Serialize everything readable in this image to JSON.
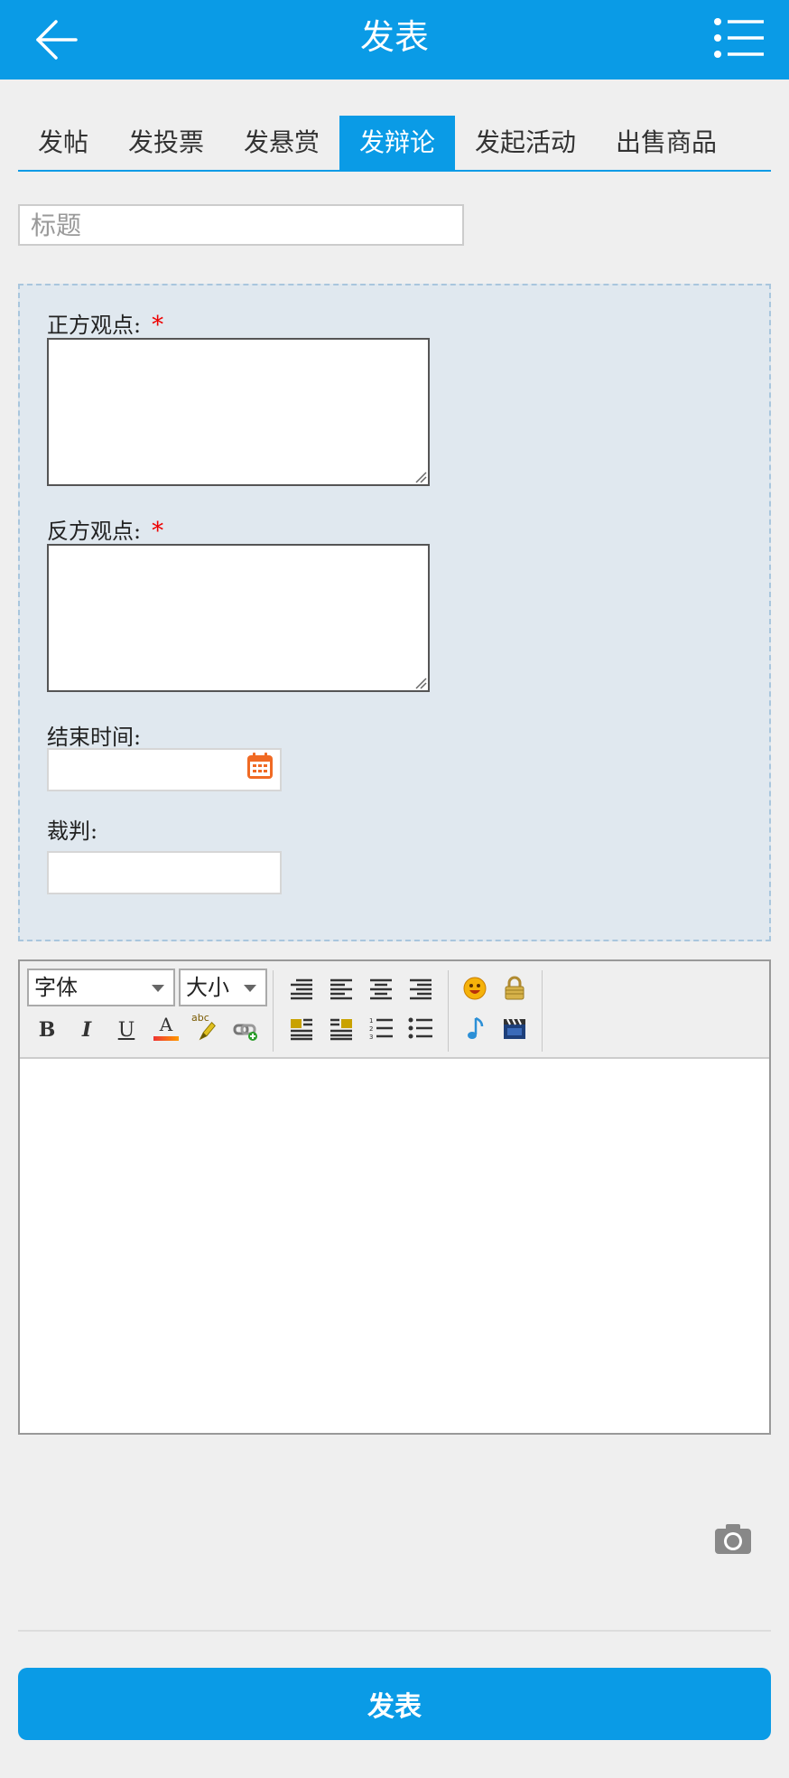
{
  "header": {
    "title": "发表"
  },
  "tabs": [
    {
      "label": "发帖",
      "active": false
    },
    {
      "label": "发投票",
      "active": false
    },
    {
      "label": "发悬赏",
      "active": false
    },
    {
      "label": "发辩论",
      "active": true
    },
    {
      "label": "发起活动",
      "active": false
    },
    {
      "label": "出售商品",
      "active": false
    }
  ],
  "form": {
    "title_placeholder": "标题",
    "affirmative_label": "正方观点:",
    "negative_label": "反方观点:",
    "required_mark": "*",
    "end_time_label": "结束时间:",
    "judge_label": "裁判:"
  },
  "editor": {
    "font_select": "字体",
    "size_select": "大小",
    "bold": "B",
    "italic": "I",
    "underline": "U",
    "text_color": "A",
    "highlight_text": "abc"
  },
  "submit_label": "发表",
  "colors": {
    "accent": "#0a9be6",
    "required": "#e00000",
    "calendar": "#f06a24"
  }
}
